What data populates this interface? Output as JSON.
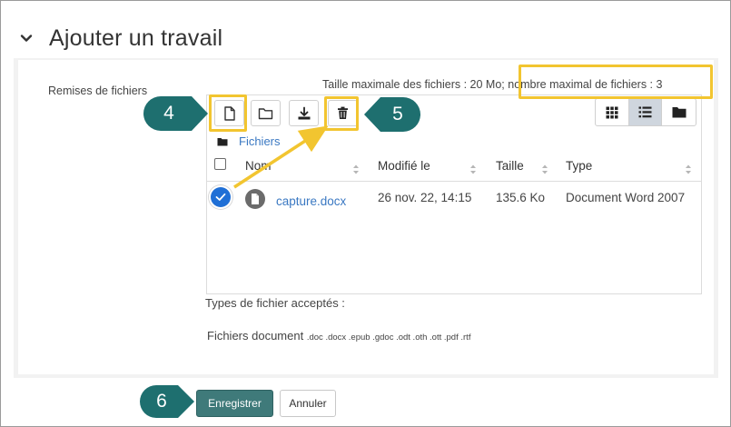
{
  "section": {
    "title": "Ajouter un travail",
    "chevron_icon": "chevron-down-icon"
  },
  "field": {
    "label": "Remises de fichiers"
  },
  "limits": {
    "max_size": "Taille maximale des fichiers : 20 Mo",
    "max_files": "; nombre maximal de fichiers : 3"
  },
  "toolbar": {
    "add_file_icon": "add-file-icon",
    "create_folder_icon": "create-folder-icon",
    "download_icon": "download-icon",
    "delete_icon": "trash-icon",
    "views": [
      "grid-view-icon",
      "list-view-icon",
      "tree-view-icon"
    ],
    "active_view": "list-view-icon"
  },
  "breadcrumb": {
    "label": "Fichiers"
  },
  "table": {
    "columns": [
      "Nom",
      "Modifié le",
      "Taille",
      "Type"
    ],
    "rows": [
      {
        "name": "capture.docx",
        "modified": "26 nov. 22, 14:15",
        "size": "135.6 Ko",
        "type": "Document Word 2007",
        "selected": true
      }
    ]
  },
  "accepted": {
    "label": "Types de fichier acceptés :",
    "group": "Fichiers document",
    "extensions": ".doc .docx .epub .gdoc .odt .oth .ott .pdf .rtf"
  },
  "buttons": {
    "save": "Enregistrer",
    "cancel": "Annuler"
  },
  "callouts": [
    "4",
    "5",
    "6"
  ],
  "colors": {
    "callout_fill": "#1e6f6f",
    "highlight": "#f2c530",
    "link": "#3a78c2",
    "checkbox": "#1f6fd6",
    "save_button": "#3f7a7a"
  }
}
